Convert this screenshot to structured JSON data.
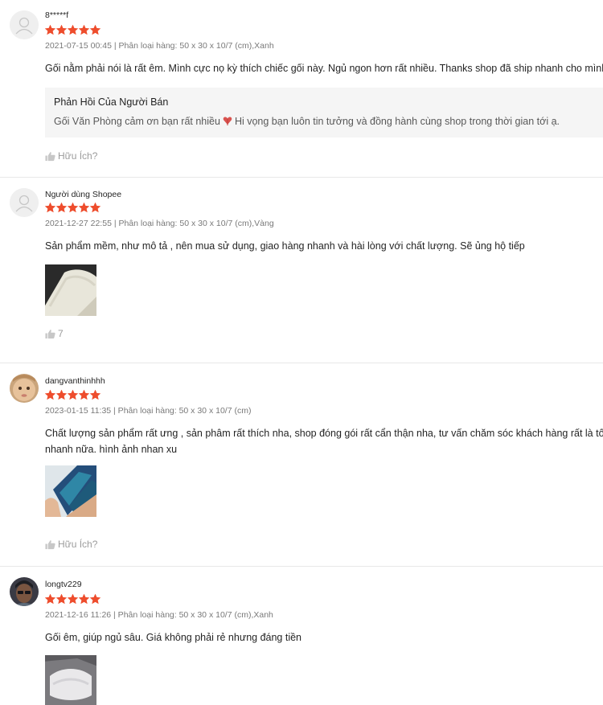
{
  "reviews": [
    {
      "username": "8*****f",
      "rating": 5,
      "meta": "2021-07-15 00:45 | Phân loại hàng: 50 x 30 x 10/7 (cm),Xanh",
      "content": "Gối nằm phải nói là rất êm. Mình cực nọ kỳ thích chiếc gối này. Ngủ ngon hơn rất nhiều. Thanks shop đã ship nhanh cho mình",
      "reply": {
        "title": "Phản Hồi Của Người Bán",
        "text_before": "Gối Văn Phòng cảm ơn bạn rất nhiều",
        "text_after": "Hi vọng bạn luôn tin tưởng và đồng hành cùng shop trong thời gian tới ạ."
      },
      "helpful_label": "Hữu Ích?"
    },
    {
      "username": "Người dùng Shopee",
      "rating": 5,
      "meta": "2021-12-27 22:55 | Phân loại hàng: 50 x 30 x 10/7 (cm),Vàng",
      "content": "Sản phẩm mềm, như mô tả , nên mua sử dụng, giao hàng nhanh và hài lòng với chất lượng. Sẽ ủng hộ tiếp",
      "helpful_label": "7"
    },
    {
      "username": "dangvanthinhhh",
      "rating": 5,
      "meta": "2023-01-15 11:35 | Phân loại hàng: 50 x 30 x 10/7 (cm)",
      "content_line1": "Chất lượng sản phẩm rất ưng , sản phâm rất thích nha, shop đóng gói rất cẩn thận nha, tư vấn chăm sóc khách hàng rất là tốt",
      "content_line2": "nhanh nữa. hình ảnh nhan xu",
      "helpful_label": "Hữu Ích?"
    },
    {
      "username": "longtv229",
      "rating": 5,
      "meta": "2021-12-16 11:26 | Phân loại hàng: 50 x 30 x 10/7 (cm),Xanh",
      "content": "Gối êm, giúp ngủ sâu. Giá không phải rẻ nhưng đáng tiền"
    }
  ],
  "colors": {
    "star": "#ee4d2d",
    "reply_bg": "#f5f5f5",
    "muted": "rgba(0,0,0,.54)"
  },
  "icons": {
    "star": "star-icon",
    "thumb": "thumbs-up-icon",
    "heart": "heart-icon",
    "default_avatar": "user-icon"
  }
}
